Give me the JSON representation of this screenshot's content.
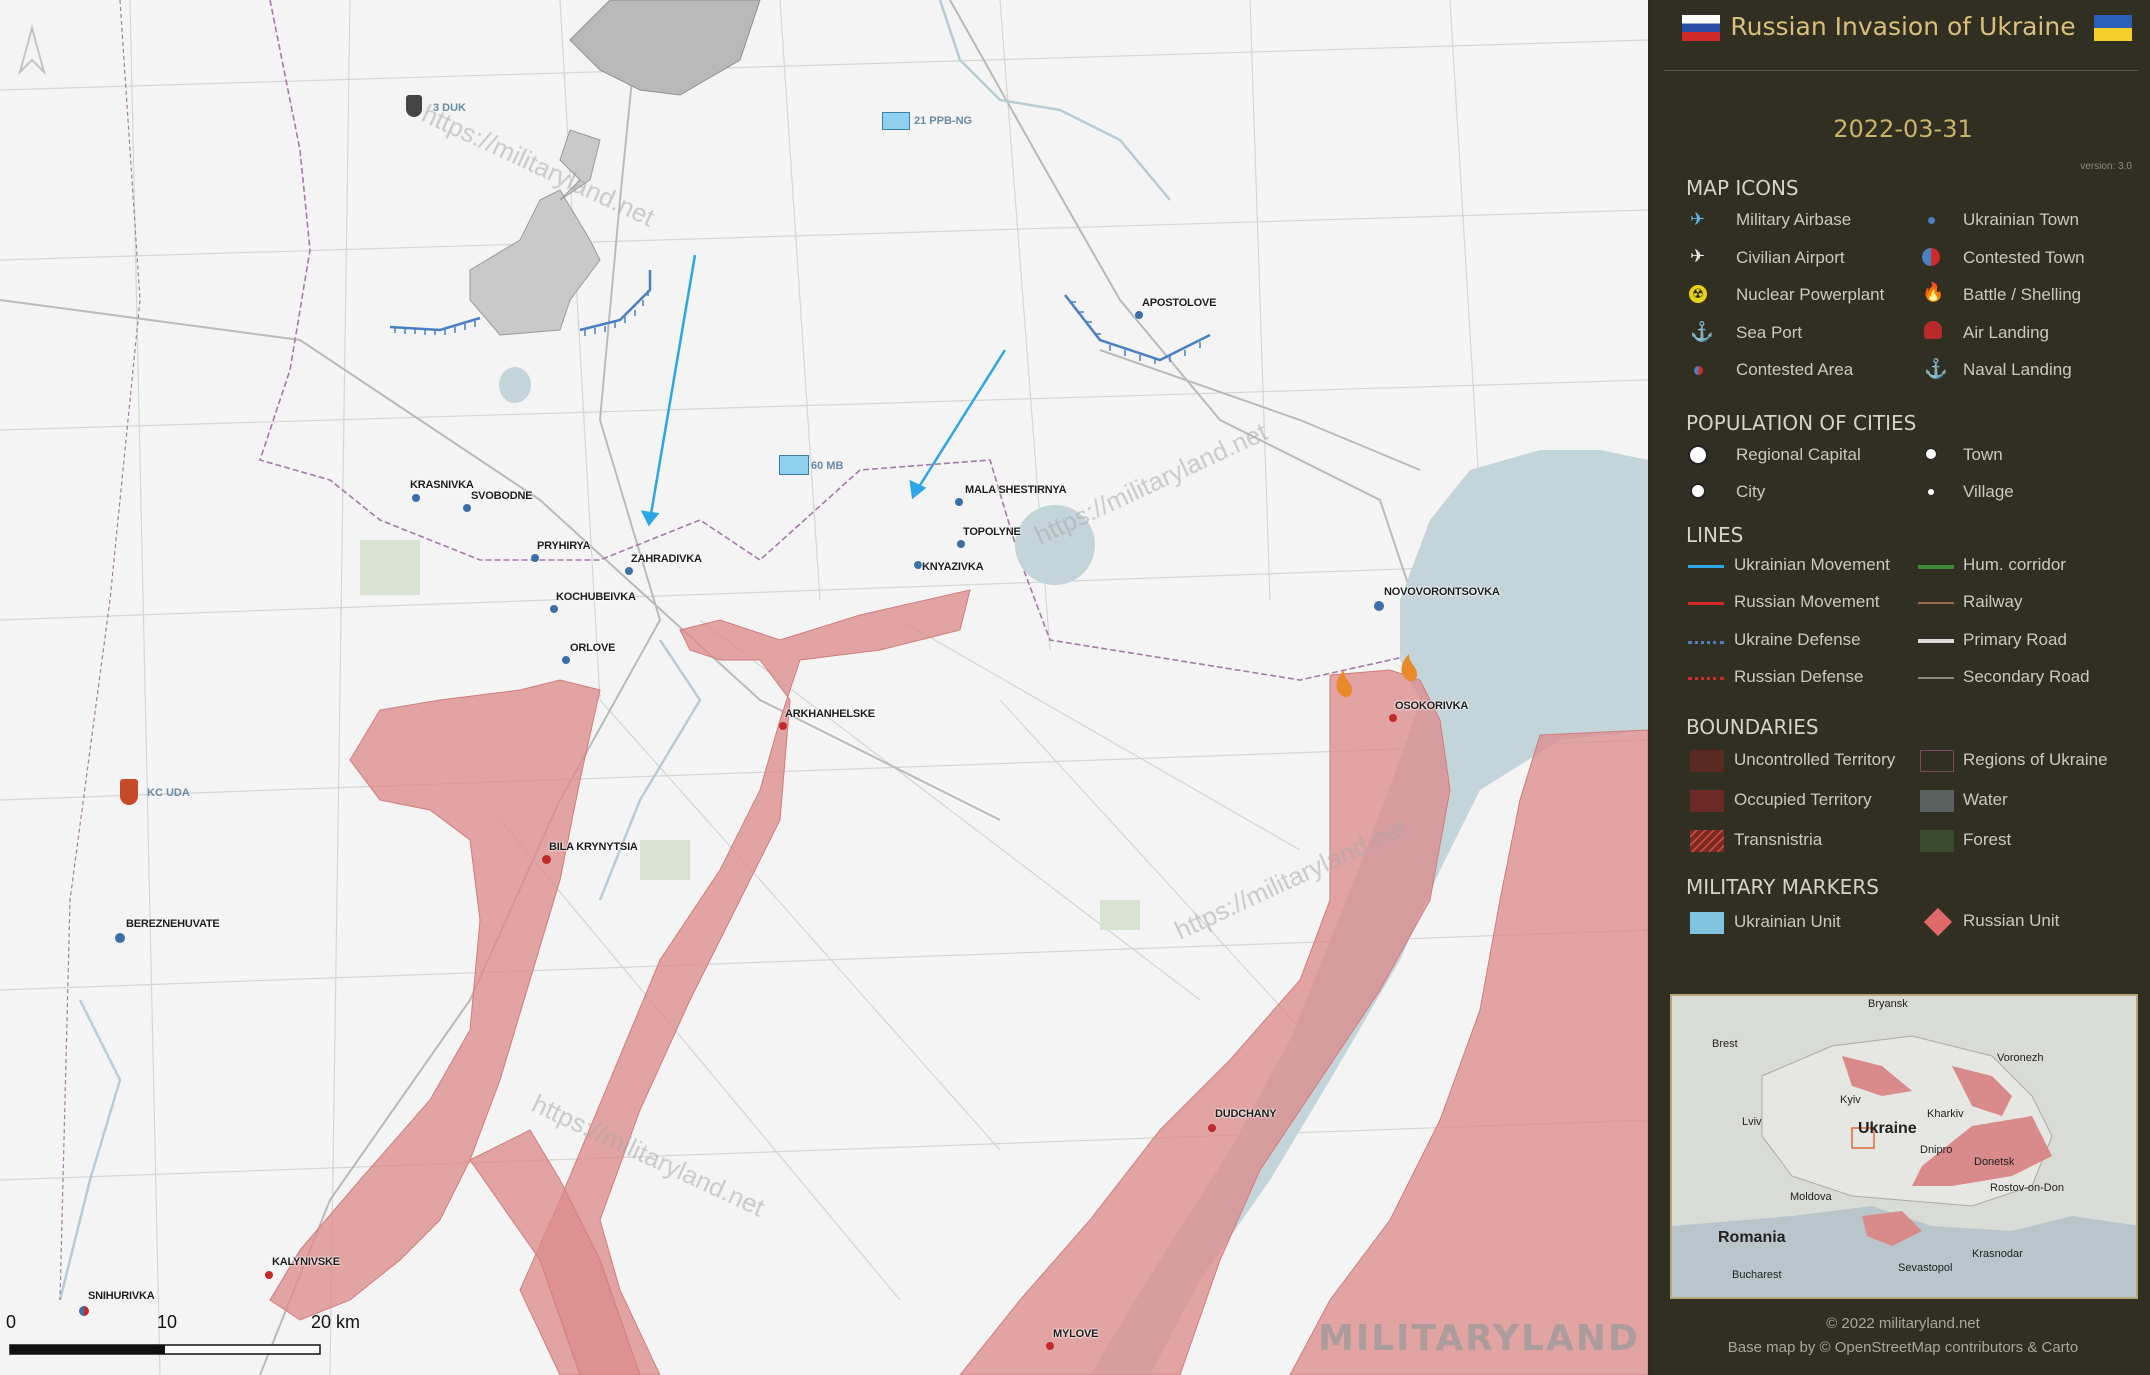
{
  "panel": {
    "title": "Russian Invasion of Ukraine",
    "date": "2022-03-31",
    "version": "version: 3.0",
    "sections": {
      "map_icons": "MAP ICONS",
      "population": "POPULATION OF CITIES",
      "lines": "LINES",
      "boundaries": "BOUNDARIES",
      "military_markers": "MILITARY MARKERS"
    },
    "map_icons": [
      {
        "label": "Military Airbase",
        "icon": "airbase-icon"
      },
      {
        "label": "Ukrainian Town",
        "icon": "ukrainian-town-icon"
      },
      {
        "label": "Civilian Airport",
        "icon": "airport-icon"
      },
      {
        "label": "Contested Town",
        "icon": "contested-town-icon"
      },
      {
        "label": "Nuclear Powerplant",
        "icon": "nuclear-icon"
      },
      {
        "label": "Battle / Shelling",
        "icon": "fire-icon"
      },
      {
        "label": "Sea Port",
        "icon": "anchor-icon"
      },
      {
        "label": "Air Landing",
        "icon": "parachute-icon"
      },
      {
        "label": "Contested Area",
        "icon": "contested-area-icon"
      },
      {
        "label": "Naval Landing",
        "icon": "naval-landing-icon"
      }
    ],
    "population": [
      {
        "label": "Regional Capital"
      },
      {
        "label": "Town"
      },
      {
        "label": "City"
      },
      {
        "label": "Village"
      }
    ],
    "lines": [
      {
        "label": "Ukrainian Movement",
        "color": "#2ea6e6"
      },
      {
        "label": "Hum. corridor",
        "color": "#3c8a3c"
      },
      {
        "label": "Russian Movement",
        "color": "#d12a2a"
      },
      {
        "label": "Railway",
        "color": "#9a6a4a"
      },
      {
        "label": "Ukraine Defense",
        "color": "#4a7fc1"
      },
      {
        "label": "Primary Road",
        "color": "#d9d9d9"
      },
      {
        "label": "Russian Defense",
        "color": "#d12a2a"
      },
      {
        "label": "Secondary Road",
        "color": "#8a8a80"
      }
    ],
    "boundaries": [
      {
        "label": "Uncontrolled Territory",
        "color": "#5a2a22"
      },
      {
        "label": "Regions of Ukraine",
        "color": "#5b2f3a"
      },
      {
        "label": "Occupied Territory",
        "color": "#6b2a25"
      },
      {
        "label": "Water",
        "color": "#59625f"
      },
      {
        "label": "Transnistria",
        "color": "#7a2a25"
      },
      {
        "label": "Forest",
        "color": "#3a4a2c"
      }
    ],
    "military": [
      {
        "label": "Ukrainian Unit",
        "color": "#7fc3e0"
      },
      {
        "label": "Russian Unit",
        "color": "#e06a6a"
      }
    ],
    "footer": {
      "copyright": "© 2022 militaryland.net",
      "basemap": "Base map by © OpenStreetMap contributors & Carto"
    },
    "inset": {
      "labels": [
        "Bryansk",
        "Brest",
        "Voronezh",
        "Kyiv",
        "Kharkiv",
        "Lviv",
        "Ukraine",
        "Dnipro",
        "Donetsk",
        "Moldova",
        "Rostov-on-Don",
        "Romania",
        "Krasnodar",
        "Bucharest",
        "Sevastopol"
      ]
    }
  },
  "map": {
    "towns": [
      {
        "name": "KRASNIVKA"
      },
      {
        "name": "SVOBODNE"
      },
      {
        "name": "PRYHIRYA"
      },
      {
        "name": "ZAHRADIVKA"
      },
      {
        "name": "KOCHUBEIVKA"
      },
      {
        "name": "ORLOVE"
      },
      {
        "name": "MALA SHESTIRNYA"
      },
      {
        "name": "TOPOLYNE"
      },
      {
        "name": "KNYAZIVKA"
      },
      {
        "name": "APOSTOLOVE"
      },
      {
        "name": "NOVOVORONTSOVKA"
      },
      {
        "name": "ARKHANHELSKE"
      },
      {
        "name": "OSOKORIVKA"
      },
      {
        "name": "BILA KRYNYTSIA"
      },
      {
        "name": "BEREZNEHUVATE"
      },
      {
        "name": "DUDCHANY"
      },
      {
        "name": "KALYNIVSKE"
      },
      {
        "name": "SNIHURIVKA"
      },
      {
        "name": "MYLOVE"
      }
    ],
    "units": [
      {
        "name": "3 DUK"
      },
      {
        "name": "21 PPB-NG"
      },
      {
        "name": "60 MB"
      },
      {
        "name": "KC UDA"
      }
    ],
    "scale": {
      "labels": [
        "0",
        "10",
        "20 km"
      ]
    },
    "watermark": "https://militaryland.net",
    "brand": "MILITARYLAND",
    "colors": {
      "occupied": "#dd8c8c",
      "water": "#c3d4da",
      "ukr_town": "#3c6ea8",
      "rus_town": "#c22a2a",
      "ukr_arrow": "#2ea6e6",
      "ukr_defense": "#4a7fc1"
    }
  }
}
